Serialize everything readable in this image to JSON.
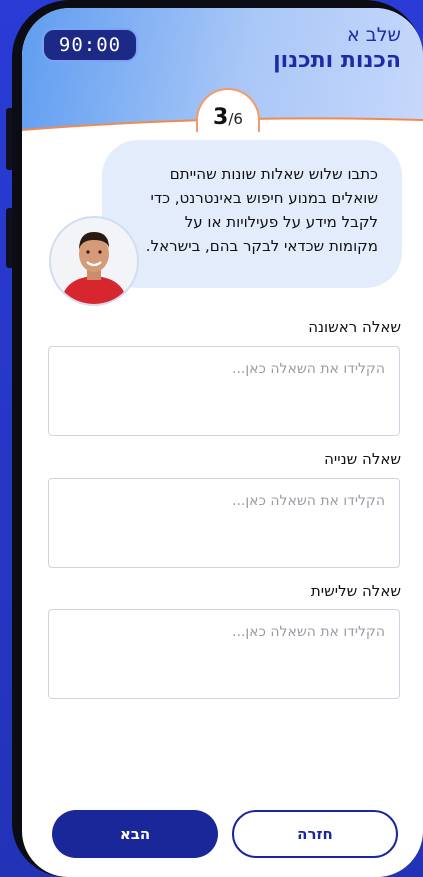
{
  "status": {
    "timer": "90:00"
  },
  "header": {
    "stage": "שלב א",
    "title": "הכנות ותכנון"
  },
  "progress": {
    "current": "3",
    "total": "/6"
  },
  "instructions": {
    "lines": [
      "כתבו שלוש שאלות שונות שהייתם",
      "שואלים במנוע חיפוש באינטרנט, כדי",
      "לקבל מידע על פעילויות או על",
      "מקומות שכדאי לבקר בהם, בישראל."
    ]
  },
  "questions": [
    {
      "label": "שאלה ראשונה",
      "placeholder": "הקלידו את השאלה כאן...",
      "value": ""
    },
    {
      "label": "שאלה שנייה",
      "placeholder": "הקלידו את השאלה כאן...",
      "value": ""
    },
    {
      "label": "שאלה שלישית",
      "placeholder": "הקלידו את השאלה כאן...",
      "value": ""
    }
  ],
  "footer": {
    "next_label": "הבא",
    "back_label": "חזרה"
  },
  "colors": {
    "primary": "#1a2799",
    "accent": "#ef8a52",
    "bubble": "#e3ecfb"
  },
  "icons": {
    "avatar": "person-avatar"
  }
}
